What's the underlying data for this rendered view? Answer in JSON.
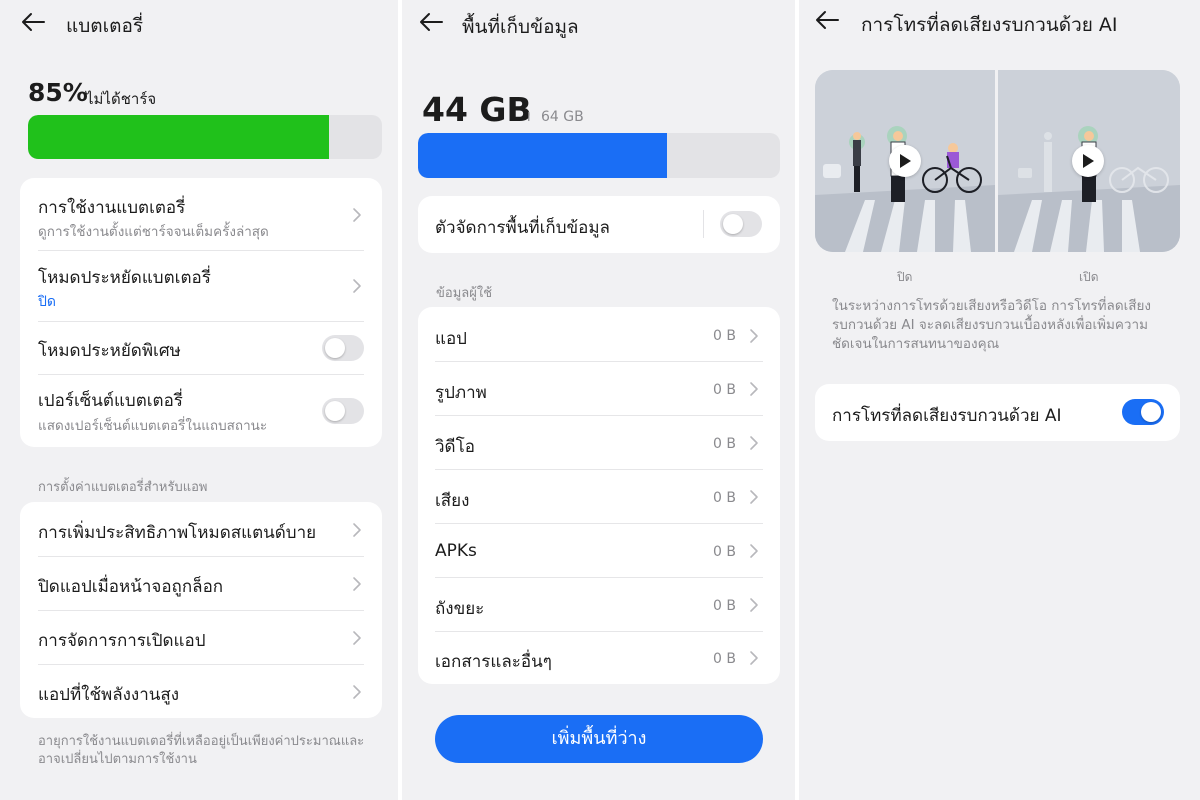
{
  "battery": {
    "title": "แบตเตอรี่",
    "percent": "85%",
    "status": "ไม่ได้ชาร์จ",
    "level": 0.85,
    "level_color": "#20c11b",
    "items": [
      {
        "title": "การใช้งานแบตเตอรี่",
        "subtitle": "ดูการใช้งานตั้งแต่ชาร์จจนเต็มครั้งล่าสุด"
      },
      {
        "title": "โหมดประหยัดแบตเตอรี่",
        "status": "ปิด"
      },
      {
        "title": "โหมดประหยัดพิเศษ",
        "toggle": false
      },
      {
        "title": "เปอร์เซ็นต์แบตเตอรี่",
        "subtitle": "แสดงเปอร์เซ็นต์แบตเตอรี่ในแถบสถานะ",
        "toggle": false
      }
    ],
    "app_section_label": "การตั้งค่าแบตเตอรี่สำหรับแอพ",
    "app_items": [
      {
        "title": "การเพิ่มประสิทธิภาพโหมดสแตนด์บาย"
      },
      {
        "title": "ปิดแอปเมื่อหน้าจอถูกล็อก"
      },
      {
        "title": "การจัดการการเปิดแอป"
      },
      {
        "title": "แอปที่ใช้พลังงานสูง"
      }
    ],
    "footnote_line1": "อายุการใช้งานแบตเตอรี่ที่เหลืออยู่เป็นเพียงค่าประมาณและ",
    "footnote_line2": "อาจเปลี่ยนไปตามการใช้งาน"
  },
  "storage": {
    "title": "พื้นที่เก็บข้อมูล",
    "used": "44 GB",
    "separator": "I",
    "total": "64 GB",
    "used_fraction": 0.6875,
    "bar_color": "#1a6ef5",
    "manager_label": "ตัวจัดการพื้นที่เก็บข้อมูล",
    "manager_toggle": false,
    "section_label": "ข้อมูลผู้ใช้",
    "items": [
      {
        "label": "แอป",
        "value": "0 B"
      },
      {
        "label": "รูปภาพ",
        "value": "0 B"
      },
      {
        "label": "วิดีโอ",
        "value": "0 B"
      },
      {
        "label": "เสียง",
        "value": "0 B"
      },
      {
        "label": "APKs",
        "value": "0 B"
      },
      {
        "label": "ถังขยะ",
        "value": "0 B"
      },
      {
        "label": "เอกสารและอื่นๆ",
        "value": "0 B"
      }
    ],
    "free_button": "เพิ่มพื้นที่ว่าง"
  },
  "ai_call": {
    "title": "การโทรที่ลดเสียงรบกวนด้วย AI",
    "label_off": "ปิด",
    "label_on": "เปิด",
    "desc_line1": "ในระหว่างการโทรด้วยเสียงหรือวิดีโอ การโทรที่ลดเสียง",
    "desc_line2": "รบกวนด้วย AI จะลดเสียงรบกวนเบื้องหลังเพื่อเพิ่มความ",
    "desc_line3": "ชัดเจนในการสนทนาของคุณ",
    "toggle_label": "การโทรที่ลดเสียงรบกวนด้วย AI",
    "toggle": true,
    "accent": "#1a6ef5"
  },
  "icons": [
    "back-arrow-icon",
    "chevron-right-icon",
    "play-icon"
  ]
}
